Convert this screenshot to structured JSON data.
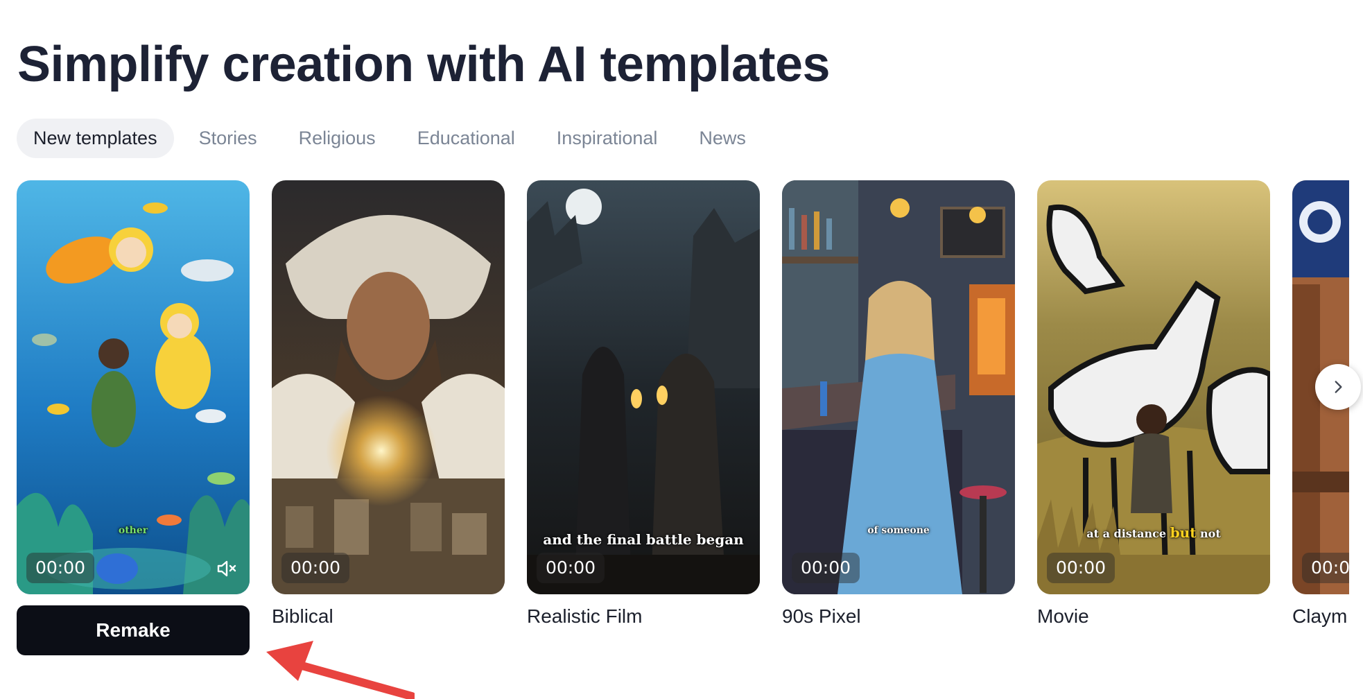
{
  "page": {
    "title": "Simplify creation with AI templates"
  },
  "tabs": [
    {
      "label": "New templates",
      "active": true
    },
    {
      "label": "Stories",
      "active": false
    },
    {
      "label": "Religious",
      "active": false
    },
    {
      "label": "Educational",
      "active": false
    },
    {
      "label": "Inspirational",
      "active": false
    },
    {
      "label": "News",
      "active": false
    }
  ],
  "cards": [
    {
      "label": "",
      "duration": "00:00",
      "caption": "other",
      "caption_color": "#7be36a",
      "muted": true,
      "show_remake": true,
      "remake_label": "Remake"
    },
    {
      "label": "Biblical",
      "duration": "00:00",
      "caption": ""
    },
    {
      "label": "Realistic Film",
      "duration": "00:00",
      "caption": "and the final battle began"
    },
    {
      "label": "90s Pixel",
      "duration": "00:00",
      "caption": "of someone"
    },
    {
      "label": "Movie",
      "duration": "00:00",
      "caption_pre": "at a distance",
      "caption_highlight": "but",
      "caption_post": "not",
      "highlight_color": "#ffd21f"
    },
    {
      "label": "Claym",
      "duration": "00:0"
    }
  ],
  "icons": {
    "mute": "speaker-muted-icon",
    "next": "chevron-right-icon",
    "annotation": "red-arrow"
  },
  "colors": {
    "title": "#1d2235",
    "tab_active_bg": "#f0f1f4",
    "tab_inactive_text": "#7b8595",
    "remake_bg": "#0c0e16",
    "annotation_arrow": "#e8433f"
  }
}
